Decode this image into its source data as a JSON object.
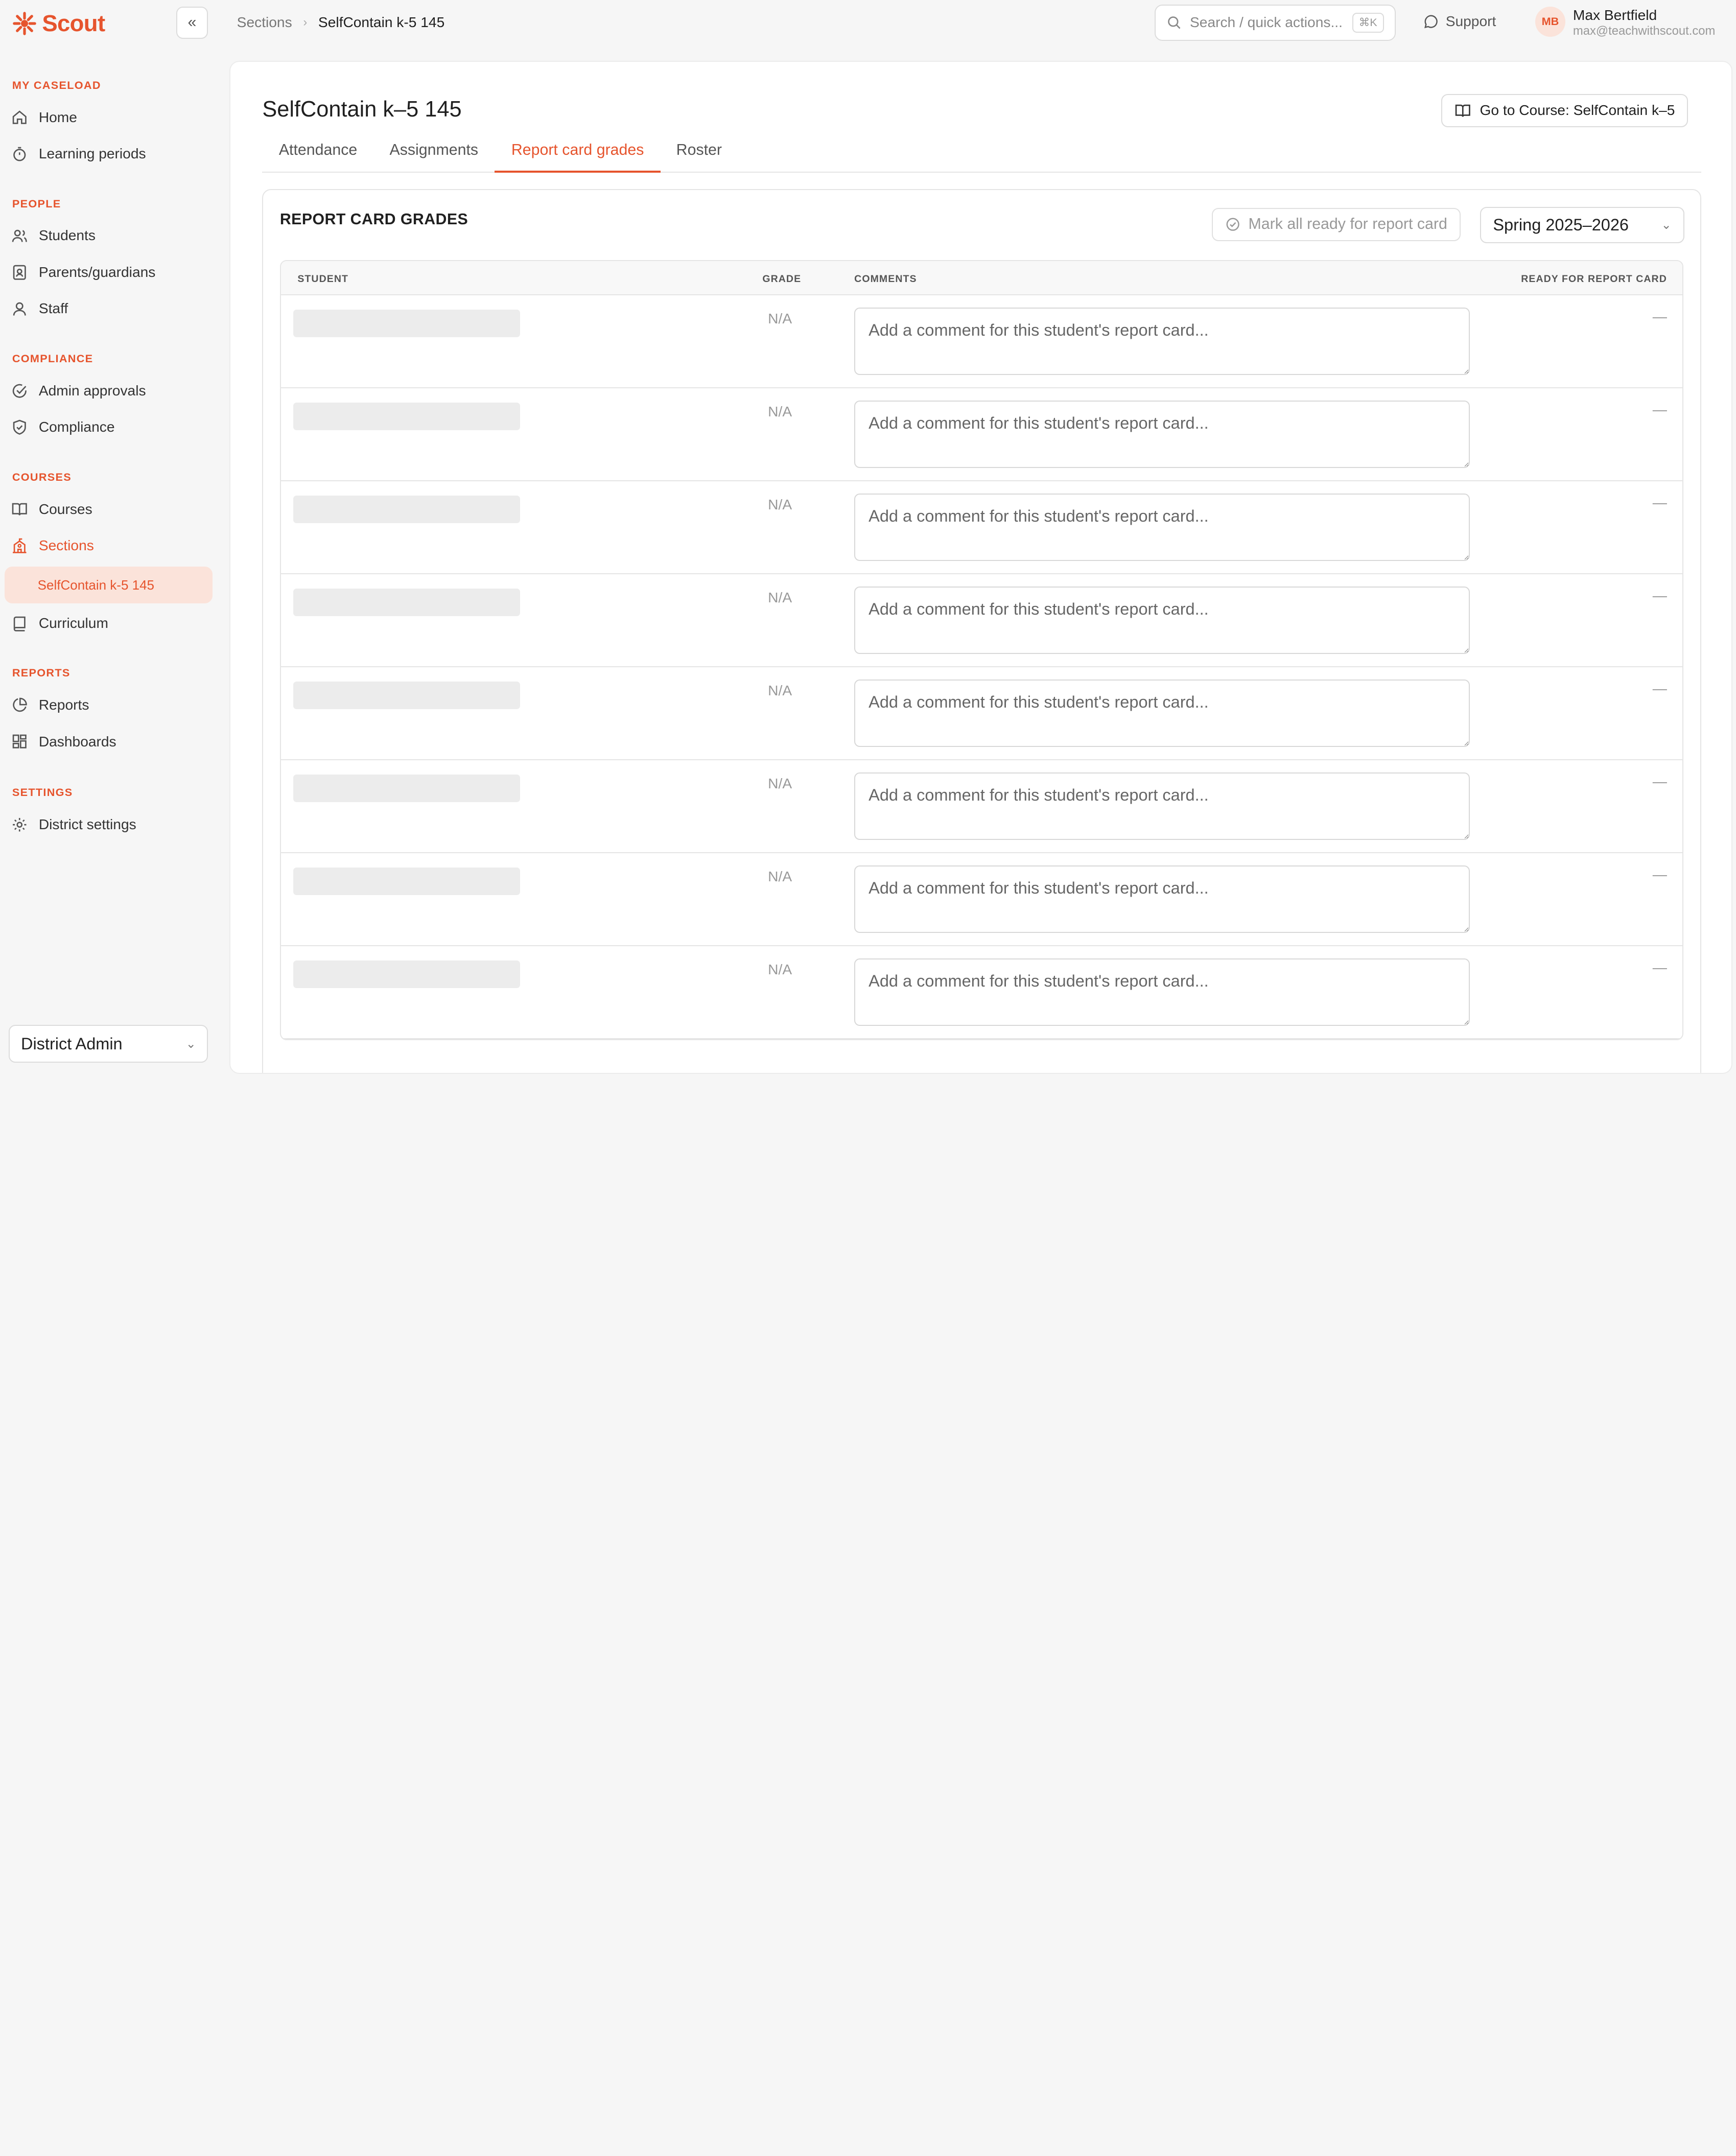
{
  "app": {
    "brand": "Scout",
    "breadcrumb": {
      "parent": "Sections",
      "current": "SelfContain k-5 145"
    },
    "search": {
      "placeholder": "Search / quick actions...",
      "shortcut": "⌘K"
    },
    "support_label": "Support",
    "user": {
      "initials": "MB",
      "name": "Max Bertfield",
      "email": "max@teachwithscout.com"
    }
  },
  "sidebar": {
    "sections": {
      "caseload": "MY CASELOAD",
      "people": "PEOPLE",
      "compliance": "COMPLIANCE",
      "courses": "COURSES",
      "reports": "REPORTS",
      "settings": "SETTINGS"
    },
    "items": {
      "home": "Home",
      "learning_periods": "Learning periods",
      "students": "Students",
      "parents": "Parents/guardians",
      "staff": "Staff",
      "admin_approvals": "Admin approvals",
      "compliance": "Compliance",
      "courses": "Courses",
      "sections": "Sections",
      "section_sub": "SelfContain k-5 145",
      "curriculum": "Curriculum",
      "reports": "Reports",
      "dashboards": "Dashboards",
      "district_settings": "District settings"
    },
    "role": "District Admin"
  },
  "main": {
    "title": "SelfContain k–5 145",
    "course_button": "Go to Course: SelfContain k–5",
    "tabs": [
      "Attendance",
      "Assignments",
      "Report card grades",
      "Roster"
    ],
    "active_tab": "Report card grades",
    "card": {
      "title": "REPORT CARD GRADES",
      "mark_all": "Mark all ready for report card",
      "term": "Spring 2025–2026",
      "columns": {
        "student": "STUDENT",
        "grade": "GRADE",
        "comments": "COMMENTS",
        "ready": "READY FOR REPORT CARD"
      },
      "rows": [
        {
          "grade": "N/A",
          "comment_placeholder": "Add a comment for this student's report card...",
          "ready": "—"
        },
        {
          "grade": "N/A",
          "comment_placeholder": "Add a comment for this student's report card...",
          "ready": "—"
        },
        {
          "grade": "N/A",
          "comment_placeholder": "Add a comment for this student's report card...",
          "ready": "—"
        },
        {
          "grade": "N/A",
          "comment_placeholder": "Add a comment for this student's report card...",
          "ready": "—"
        },
        {
          "grade": "N/A",
          "comment_placeholder": "Add a comment for this student's report card...",
          "ready": "—"
        },
        {
          "grade": "N/A",
          "comment_placeholder": "Add a comment for this student's report card...",
          "ready": "—"
        },
        {
          "grade": "N/A",
          "comment_placeholder": "Add a comment for this student's report card...",
          "ready": "—"
        },
        {
          "grade": "N/A",
          "comment_placeholder": "Add a comment for this student's report card...",
          "ready": "—"
        }
      ]
    }
  },
  "colors": {
    "accent": "#e6542d",
    "accent_soft": "#fbe3da"
  }
}
